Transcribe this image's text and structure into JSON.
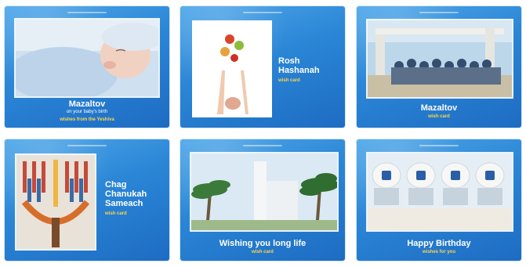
{
  "cards": [
    {
      "title": "Mazaltov",
      "subtitle": "on your baby's birth",
      "tag": "wishes from the Yeshiva",
      "image": "sleeping-baby"
    },
    {
      "title_line1": "Rosh",
      "title_line2": "Hashanah",
      "tag": "wish card",
      "image": "apples-thrown"
    },
    {
      "title": "Mazaltov",
      "tag": "wish card",
      "image": "group-at-gate"
    },
    {
      "title_line1": "Chag",
      "title_line2": "Chanukah",
      "title_line3": "Sameach",
      "tag": "wish card",
      "image": "menorah"
    },
    {
      "title": "Wishing you long life",
      "tag": "wish card",
      "image": "palm-trees-building"
    },
    {
      "title": "Happy Birthday",
      "tag": "wishes for you",
      "image": "cupcakes-with-logo"
    }
  ],
  "colors": {
    "card_bg": "#2b86d6",
    "tag": "#ffd54a",
    "title": "#ffffff"
  }
}
